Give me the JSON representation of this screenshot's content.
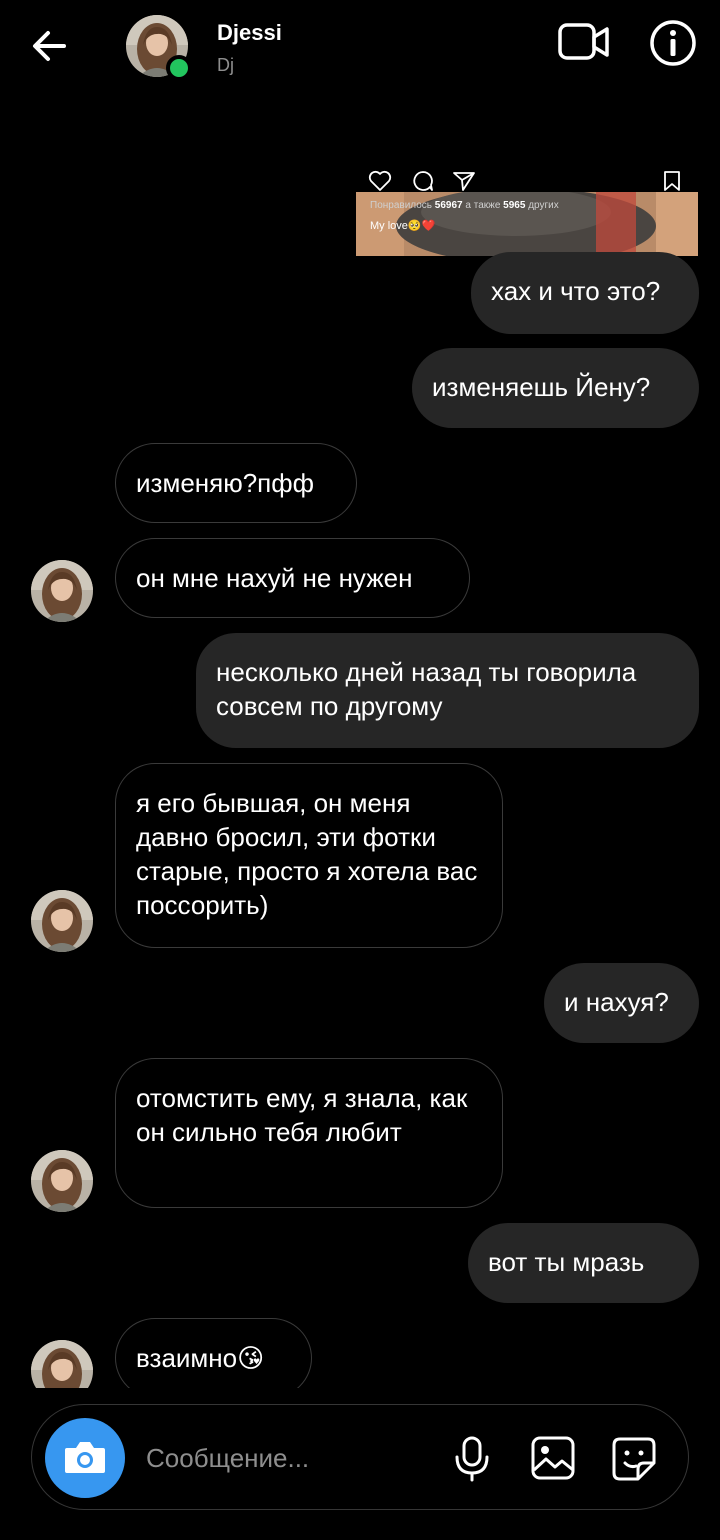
{
  "header": {
    "contact_name": "Djessi",
    "contact_username": "Dj"
  },
  "shared_post": {
    "likes_prefix": "Понравилось ",
    "likes_count": "56967",
    "likes_middle": " а также ",
    "others_count": "5965",
    "likes_suffix": " других",
    "caption": "My love🥺❤️"
  },
  "messages": [
    {
      "direction": "outgoing",
      "text": "хах и что это?"
    },
    {
      "direction": "outgoing",
      "text": "изменяешь Йену?"
    },
    {
      "direction": "incoming",
      "text": "изменяю?пфф"
    },
    {
      "direction": "incoming",
      "text": "он мне нахуй не нужен"
    },
    {
      "direction": "outgoing",
      "text": "несколько дней назад ты говорила совсем по другому"
    },
    {
      "direction": "incoming",
      "text": "я его бывшая, он меня давно бросил, эти фотки старые, просто я хотела вас поссорить)"
    },
    {
      "direction": "outgoing",
      "text": "и нахуя?"
    },
    {
      "direction": "incoming",
      "text": "отомстить ему, я знала, как он сильно тебя любит"
    },
    {
      "direction": "outgoing",
      "text": "вот ты мразь"
    },
    {
      "direction": "incoming",
      "text": "взаимно😘"
    }
  ],
  "composer": {
    "placeholder": "Сообщение..."
  },
  "colors": {
    "background": "#000000",
    "outgoing_bubble": "#262626",
    "incoming_border": "#3a3a3a",
    "online": "#22c55e",
    "camera_button": "#3797f0"
  }
}
